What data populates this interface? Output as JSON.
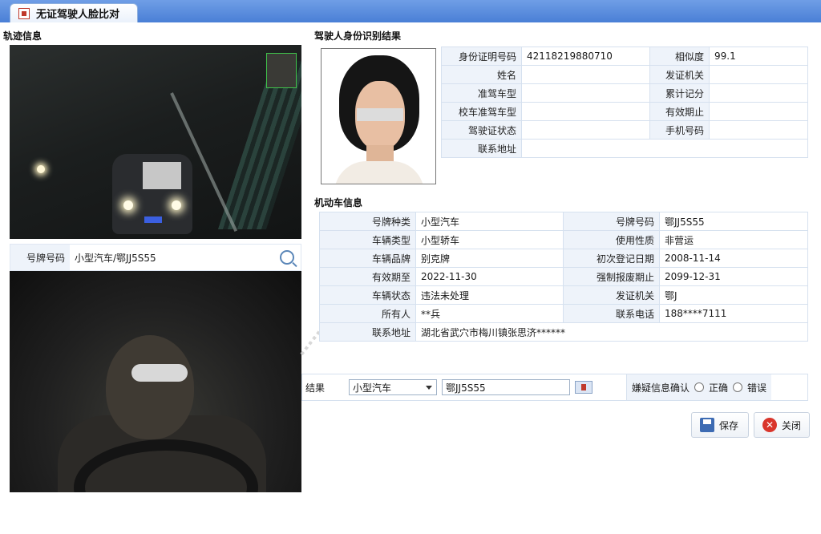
{
  "tab": {
    "title": "无证驾驶人脸比对"
  },
  "sections": {
    "track": "轨迹信息",
    "identity": "驾驶人身份识别结果",
    "vehicle": "机动车信息"
  },
  "track": {
    "plate_label": "号牌号码",
    "plate_value": "小型汽车/鄂JJ5S55"
  },
  "identity": {
    "rows": [
      {
        "l1": "身份证明号码",
        "v1": "42118219880710",
        "l2": "相似度",
        "v2": "99.1"
      },
      {
        "l1": "姓名",
        "v1": "",
        "l2": "发证机关",
        "v2": ""
      },
      {
        "l1": "准驾车型",
        "v1": "",
        "l2": "累计记分",
        "v2": ""
      },
      {
        "l1": "校车准驾车型",
        "v1": "",
        "l2": "有效期止",
        "v2": ""
      },
      {
        "l1": "驾驶证状态",
        "v1": "",
        "l2": "手机号码",
        "v2": ""
      }
    ],
    "address_label": "联系地址",
    "address_value": ""
  },
  "vehicle": {
    "rows": [
      {
        "l1": "号牌种类",
        "v1": "小型汽车",
        "l2": "号牌号码",
        "v2": "鄂JJ5S55"
      },
      {
        "l1": "车辆类型",
        "v1": "小型轿车",
        "l2": "使用性质",
        "v2": "非营运"
      },
      {
        "l1": "车辆品牌",
        "v1": "别克牌",
        "l2": "初次登记日期",
        "v2": "2008-11-14"
      },
      {
        "l1": "有效期至",
        "v1": "2022-11-30",
        "l2": "强制报废期止",
        "v2": "2099-12-31"
      },
      {
        "l1": "车辆状态",
        "v1": "违法未处理",
        "l2": "发证机关",
        "v2": "鄂J"
      },
      {
        "l1": "所有人",
        "v1": "**兵",
        "l2": "联系电话",
        "v2": "188****7111"
      }
    ],
    "address_label": "联系地址",
    "address_value": "湖北省武穴市梅川镇张思济******"
  },
  "form": {
    "result_label": "结果",
    "plate_type_selected": "小型汽车",
    "plate_input": "鄂JJ5S55",
    "confirm_label": "嫌疑信息确认",
    "opt_correct": "正确",
    "opt_wrong": "错误"
  },
  "buttons": {
    "save": "保存",
    "close": "关闭"
  }
}
